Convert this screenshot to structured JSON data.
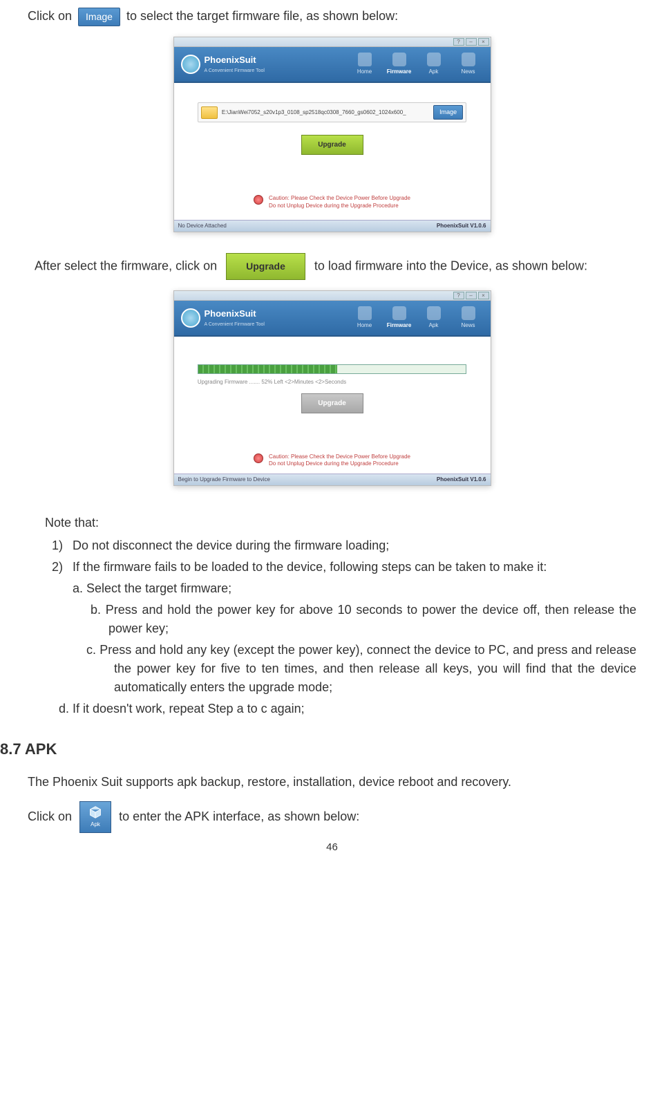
{
  "intro1_a": "Click on",
  "intro1_b": "to select the target firmware file, as shown below:",
  "image_btn": "Image",
  "upgrade_btn": "Upgrade",
  "app": {
    "name": "PhoenixSuit",
    "subtitle": "A Convenient Firmware Tool",
    "nav": {
      "home": "Home",
      "firmware": "Firmware",
      "apk": "Apk",
      "news": "News"
    },
    "file_path": "E:\\JianWei7052_s20v1p3_0108_sp2518qc0308_7660_gs0602_1024x600_",
    "caution_l1": "Caution: Please Check the Device Power Before Upgrade",
    "caution_l2": "Do not Unplug Device during the Upgrade Procedure",
    "status_left_1": "No Device Attached",
    "status_left_2": "Begin to Upgrade Firmware to Device",
    "status_right": "PhoenixSuit V1.0.6",
    "progress_text": "Upgrading Firmware ....... 52%     Left <2>Minutes <2>Seconds",
    "tb_help": "?",
    "tb_min": "–",
    "tb_close": "×"
  },
  "intro2_a": "After select the firmware, click on",
  "intro2_b": "to load firmware into the Device, as shown below:",
  "notes": {
    "head": "Note that:",
    "n1": "Do not disconnect the device during the firmware loading;",
    "n2": "If the firmware fails to be loaded to the device, following steps can be taken to make it:",
    "a": "a. Select the target firmware;",
    "b": "b. Press and hold the power key for above 10 seconds to power the device off, then release the power key;",
    "c": "c.    Press and hold any key (except the power key), connect the device to PC, and press and release the power key for five to ten times, and then release all keys, you will find that the device automatically enters the upgrade mode;",
    "d": "d. If it doesn't work, repeat Step a to c again;"
  },
  "section87": "8.7 APK",
  "apk_text": "The Phoenix Suit supports apk backup, restore, installation, device reboot and recovery.",
  "apk_click_a": "Click on",
  "apk_click_b": "to enter the APK interface, as shown below:",
  "apk_label": "Apk",
  "page": "46"
}
